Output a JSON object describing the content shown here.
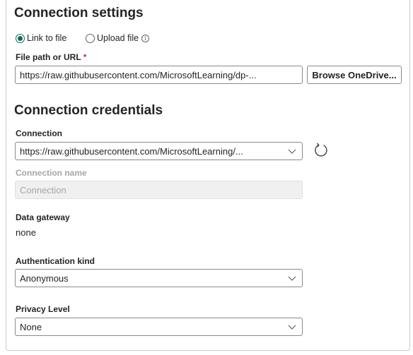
{
  "connection_settings": {
    "title": "Connection settings",
    "radio_link": "Link to file",
    "radio_upload": "Upload file",
    "info_glyph": "i",
    "file_path_label": "File path or URL",
    "required_mark": "*",
    "file_path_value": "https://raw.githubusercontent.com/MicrosoftLearning/dp-...",
    "browse_button": "Browse OneDrive..."
  },
  "connection_credentials": {
    "title": "Connection credentials",
    "connection_label": "Connection",
    "connection_value": "https://raw.githubusercontent.com/MicrosoftLearning/...",
    "connection_name_label": "Connection name",
    "connection_name_placeholder": "Connection",
    "data_gateway_label": "Data gateway",
    "data_gateway_value": "none",
    "auth_kind_label": "Authentication kind",
    "auth_kind_value": "Anonymous",
    "privacy_level_label": "Privacy Level",
    "privacy_level_value": "None"
  },
  "icons": {
    "chevron": "chevron-down-icon",
    "refresh": "refresh-icon",
    "info": "info-icon"
  },
  "colors": {
    "accent": "#0f6b5c",
    "required": "#c4314b",
    "disabled_text": "#a6a6a6"
  }
}
